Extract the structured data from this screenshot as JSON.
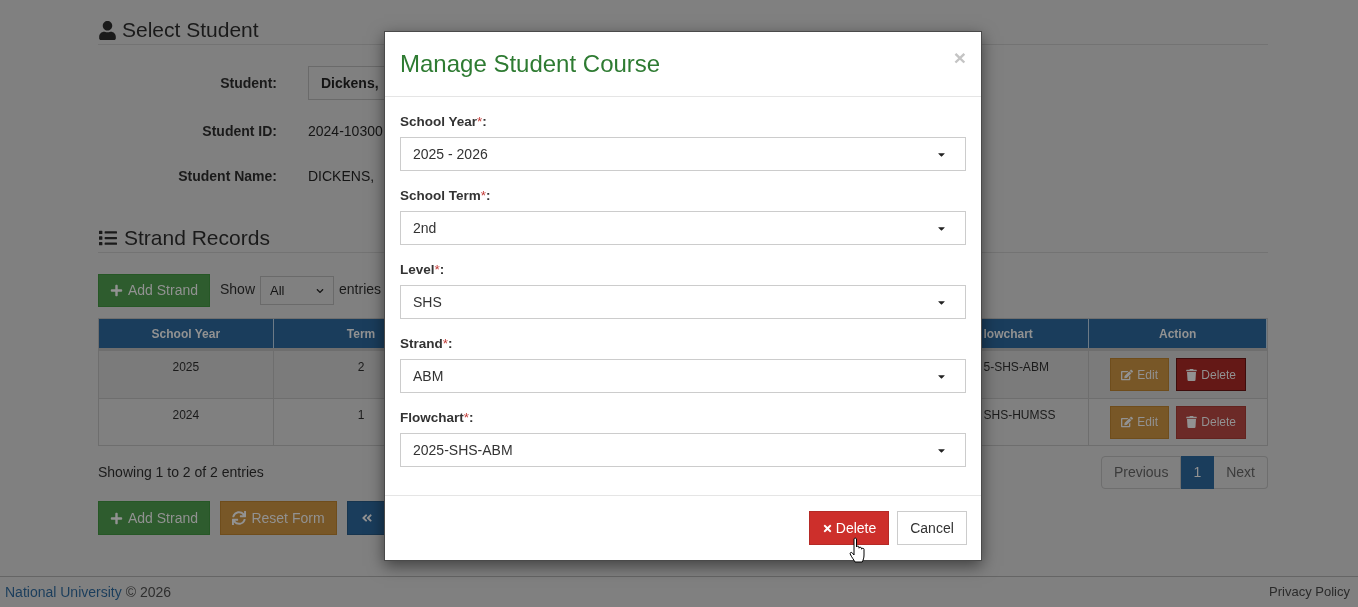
{
  "select_student": {
    "title": "Select Student",
    "fields": [
      {
        "kind": "select",
        "label": "Student:",
        "value": "Dickens,"
      },
      {
        "kind": "text",
        "label": "Student ID:",
        "value": "2024-10300"
      },
      {
        "kind": "text",
        "label": "Student Name:",
        "value": "DICKENS,"
      }
    ]
  },
  "strand_records": {
    "title": "Strand Records",
    "add_button": "Add Strand",
    "length_menu": {
      "prefix": "Show",
      "value": "All",
      "suffix": "entries"
    },
    "table": {
      "columns": [
        "School Year",
        "Term",
        "lowchart",
        "Action"
      ],
      "rows": [
        {
          "cells": [
            "2025",
            "2",
            "5-SHS-ABM"
          ],
          "actions": [
            {
              "kind": "edit",
              "label": "Edit",
              "pressed": false
            },
            {
              "kind": "delete",
              "label": "Delete",
              "pressed": true
            }
          ]
        },
        {
          "cells": [
            "2024",
            "1",
            "SHS-HUMSS"
          ],
          "actions": [
            {
              "kind": "edit",
              "label": "Edit",
              "pressed": false
            },
            {
              "kind": "delete",
              "label": "Delete",
              "pressed": false
            }
          ]
        }
      ]
    },
    "info": "Showing 1 to 2 of 2 entries",
    "pagination": [
      {
        "label": "Previous",
        "selected": false
      },
      {
        "label": "1",
        "selected": true
      },
      {
        "label": "Next",
        "selected": false
      }
    ]
  },
  "form_buttons": [
    {
      "kind": "add",
      "label": "Add Strand"
    },
    {
      "kind": "reset",
      "label": "Reset Form"
    },
    {
      "kind": "back"
    }
  ],
  "footer": {
    "link": "National University",
    "copyright": "© 2026",
    "right_link": "Privacy Policy"
  },
  "modal": {
    "title": "Manage Student Course",
    "close": "×",
    "fields": [
      {
        "label": "School Year",
        "required_mark": "*",
        "colon": ":",
        "value": "2025 - 2026"
      },
      {
        "label": "School Term",
        "required_mark": "*",
        "colon": ":",
        "value": "2nd"
      },
      {
        "label": "Level",
        "required_mark": "*",
        "colon": ":",
        "value": "SHS"
      },
      {
        "label": "Strand",
        "required_mark": "*",
        "colon": ":",
        "value": "ABM"
      },
      {
        "label": "Flowchart",
        "required_mark": "*",
        "colon": ":",
        "value": "2025-SHS-ABM"
      }
    ],
    "buttons": [
      {
        "kind": "delete",
        "label": "Delete"
      },
      {
        "kind": "cancel",
        "label": "Cancel"
      }
    ]
  }
}
